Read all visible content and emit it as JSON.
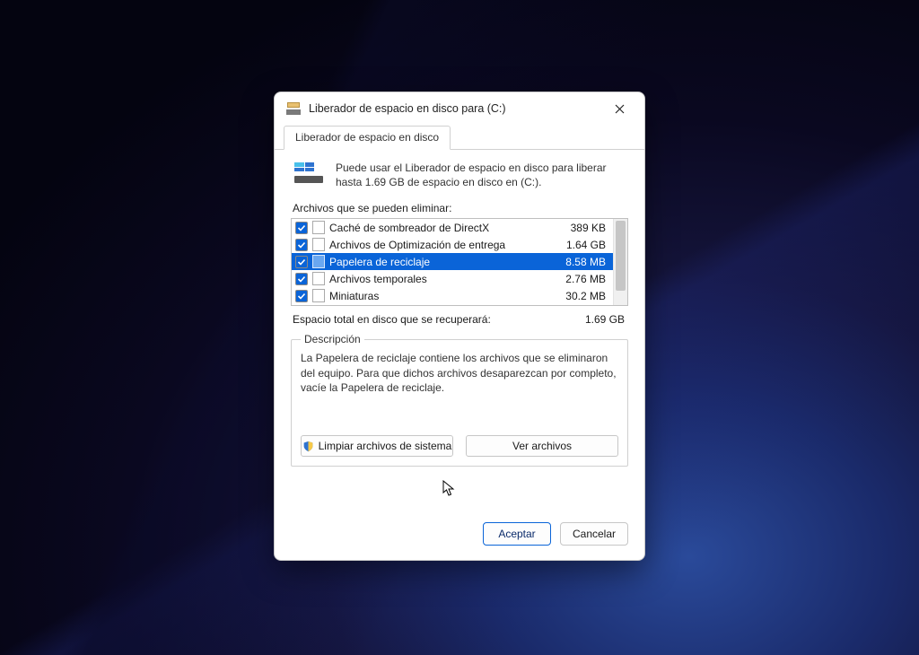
{
  "window": {
    "title": "Liberador de espacio en disco para  (C:)"
  },
  "tab": {
    "label": "Liberador de espacio en disco"
  },
  "info": {
    "text": "Puede usar el Liberador de espacio en disco para liberar hasta 1.69 GB de espacio en disco en  (C:)."
  },
  "list": {
    "header": "Archivos que se pueden eliminar:",
    "items": [
      {
        "checked": true,
        "label": "Caché de sombreador de DirectX",
        "size": "389 KB",
        "selected": false
      },
      {
        "checked": true,
        "label": "Archivos de Optimización de entrega",
        "size": "1.64 GB",
        "selected": false
      },
      {
        "checked": true,
        "label": "Papelera de reciclaje",
        "size": "8.58 MB",
        "selected": true
      },
      {
        "checked": true,
        "label": "Archivos temporales",
        "size": "2.76 MB",
        "selected": false
      },
      {
        "checked": true,
        "label": "Miniaturas",
        "size": "30.2 MB",
        "selected": false
      }
    ]
  },
  "total": {
    "label": "Espacio total en disco que se recuperará:",
    "value": "1.69 GB"
  },
  "description": {
    "legend": "Descripción",
    "text": "La Papelera de reciclaje contiene los archivos que se eliminaron del equipo. Para que dichos archivos desaparezcan por completo, vacíe la Papelera de reciclaje.",
    "clean_button": "Limpiar archivos de sistema",
    "view_button": "Ver archivos"
  },
  "dialog_buttons": {
    "ok": "Aceptar",
    "cancel": "Cancelar"
  }
}
